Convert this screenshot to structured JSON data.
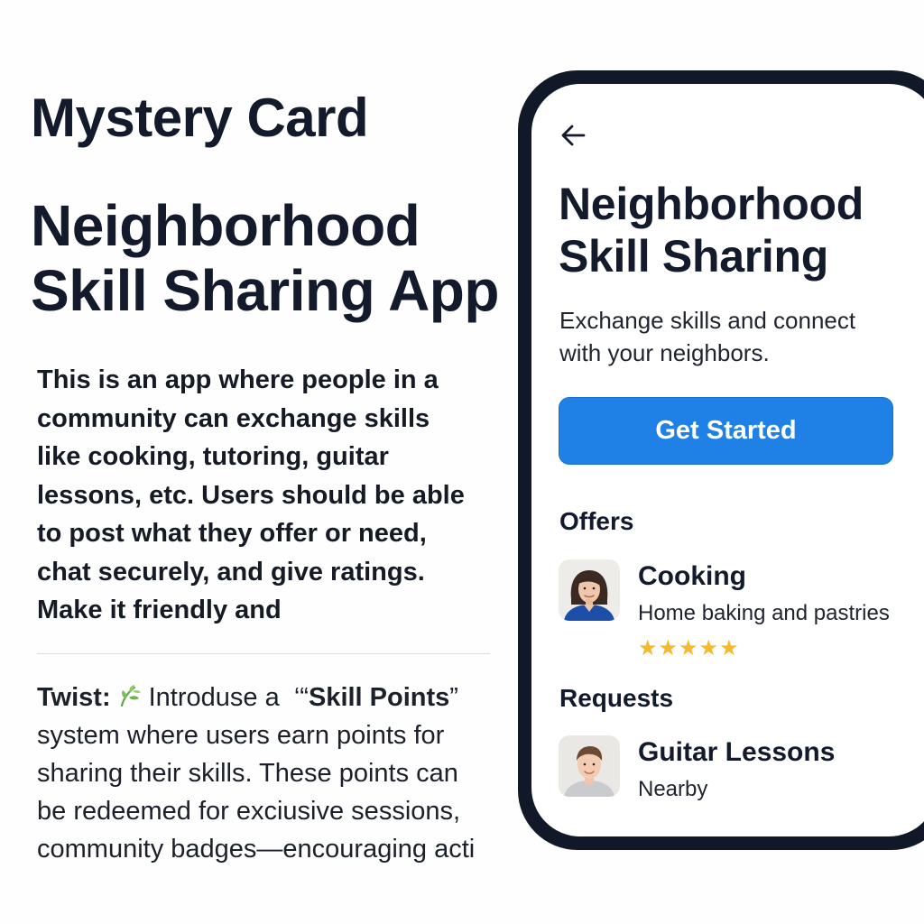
{
  "card": {
    "label": "Mystery Card",
    "title_lines": [
      "Neighborhood",
      "Skill Sharing App"
    ],
    "brief_lines": [
      "This is an app where people in a",
      "community can exchange skills",
      "like cooking, tutoring, guitar",
      "lessons, etc. Users should be able",
      "to post what they offer or need,",
      "chat securely, and give ratings.",
      "Make it friendly and"
    ],
    "twist": {
      "label": "Twist:",
      "icon": "leaf-icon",
      "intro": "Introduse a",
      "quote_open": "‘“",
      "highlight": "Skill Points",
      "quote_close": "”",
      "lines": [
        "system where users earn points for",
        "sharing their skills. These points can",
        "be redeemed for exciusive sessions,",
        "community badges—encouraging acti"
      ]
    }
  },
  "phone": {
    "back_icon": "arrow-left-icon",
    "title_lines": [
      "Neighborhood",
      "Skill Sharing"
    ],
    "subtitle_lines": [
      "Exchange skills and connect",
      "with your neighbors."
    ],
    "cta_label": "Get Started",
    "cta_color": "#1f80e6",
    "offers": {
      "heading": "Offers",
      "items": [
        {
          "title": "Cooking",
          "desc": "Home baking and pastries",
          "rating": 5,
          "stars": "★★★★★",
          "avatar": "woman-avatar"
        }
      ]
    },
    "requests": {
      "heading": "Requests",
      "items": [
        {
          "title": "Guitar Lessons",
          "desc": "Nearby",
          "avatar": "man-avatar"
        }
      ]
    }
  }
}
